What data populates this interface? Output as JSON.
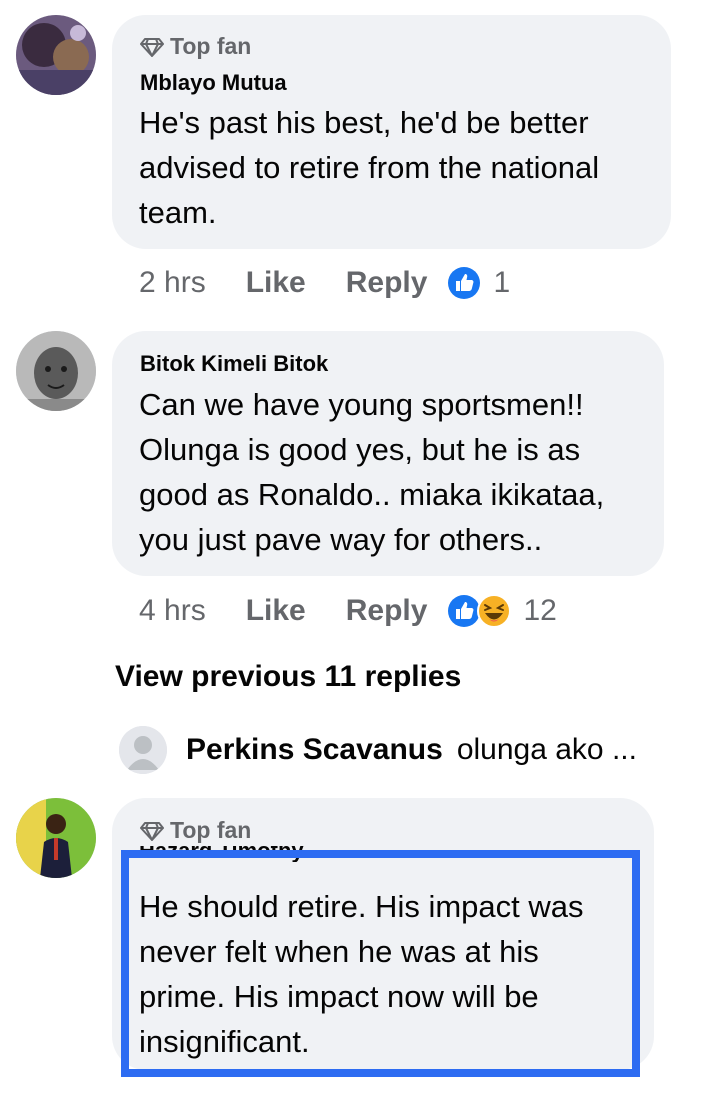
{
  "comments": [
    {
      "badge": "Top fan",
      "author": "Mblayo Mutua",
      "text": "He's past his best, he'd be better\nadvised to retire from the national\nteam.",
      "time": "2 hrs",
      "like_label": "Like",
      "reply_label": "Reply",
      "reaction_count": "1",
      "reactions": [
        "like-icon"
      ]
    },
    {
      "author": "Bitok Kimeli Bitok",
      "text": "Can we have young sportsmen!!\nOlunga is good yes, but he is as\ngood as Ronaldo.. miaka ikikataa,\nyou just pave way for others..",
      "time": "4 hrs",
      "like_label": "Like",
      "reply_label": "Reply",
      "reaction_count": "12",
      "reactions": [
        "like-icon",
        "haha-icon"
      ]
    },
    {
      "badge": "Top fan",
      "author": "Hazard Timothy",
      "text": "He should retire. His impact was\nnever felt when he was at his\nprime. His impact now will be\ninsignificant."
    }
  ],
  "view_previous": "View previous 11 replies",
  "reply_preview": {
    "name": "Perkins Scavanus",
    "text": "olunga ako ..."
  },
  "colors": {
    "bubble": "#f0f2f5",
    "secondary_text": "#65676b",
    "like_blue": "#1877f2",
    "highlight": "#2d6cf2"
  }
}
